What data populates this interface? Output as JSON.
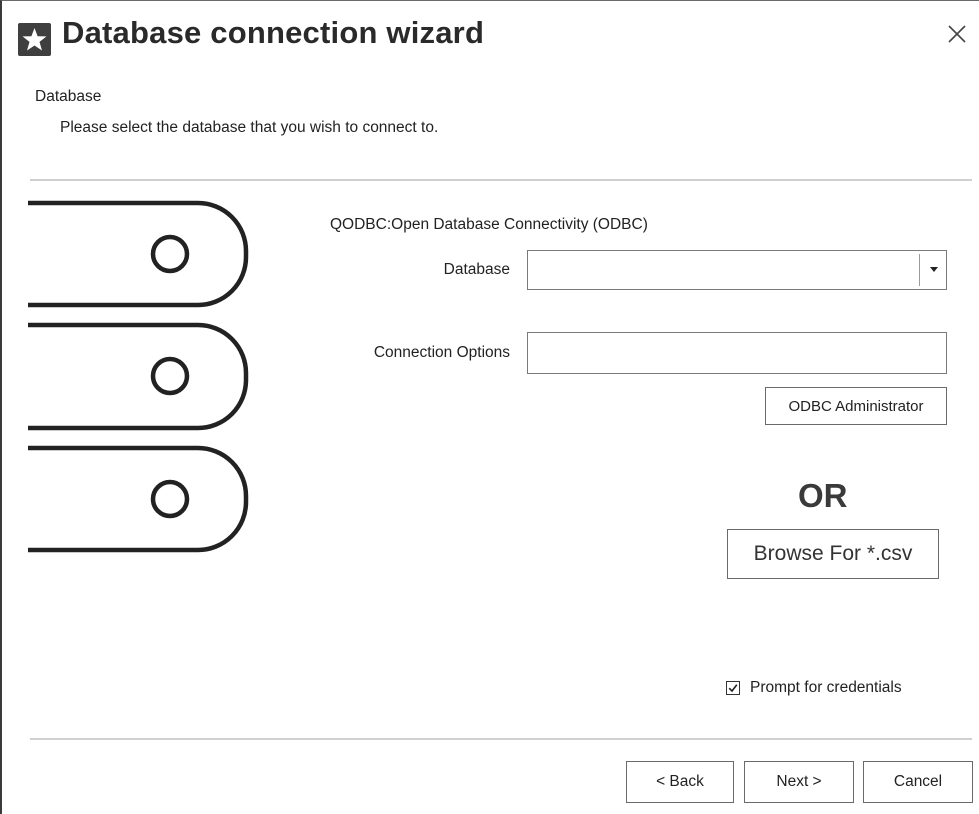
{
  "window": {
    "title": "Database connection wizard",
    "icon": "star-icon",
    "close_icon": "close-icon"
  },
  "header": {
    "section_title": "Database",
    "description": "Please select the database that you wish to connect to."
  },
  "illustration": {
    "icon": "database-stack-icon"
  },
  "form": {
    "driver_label": "QODBC:Open Database Connectivity (ODBC)",
    "database_label": "Database",
    "database_value": "",
    "connection_options_label": "Connection Options",
    "connection_options_value": "",
    "odbc_admin_button": "ODBC Administrator",
    "or_text": "OR",
    "browse_csv_button": "Browse For *.csv",
    "prompt_credentials_label": "Prompt for credentials",
    "prompt_credentials_checked": true
  },
  "footer": {
    "back_button": "< Back",
    "next_button": "Next >",
    "cancel_button": "Cancel"
  }
}
